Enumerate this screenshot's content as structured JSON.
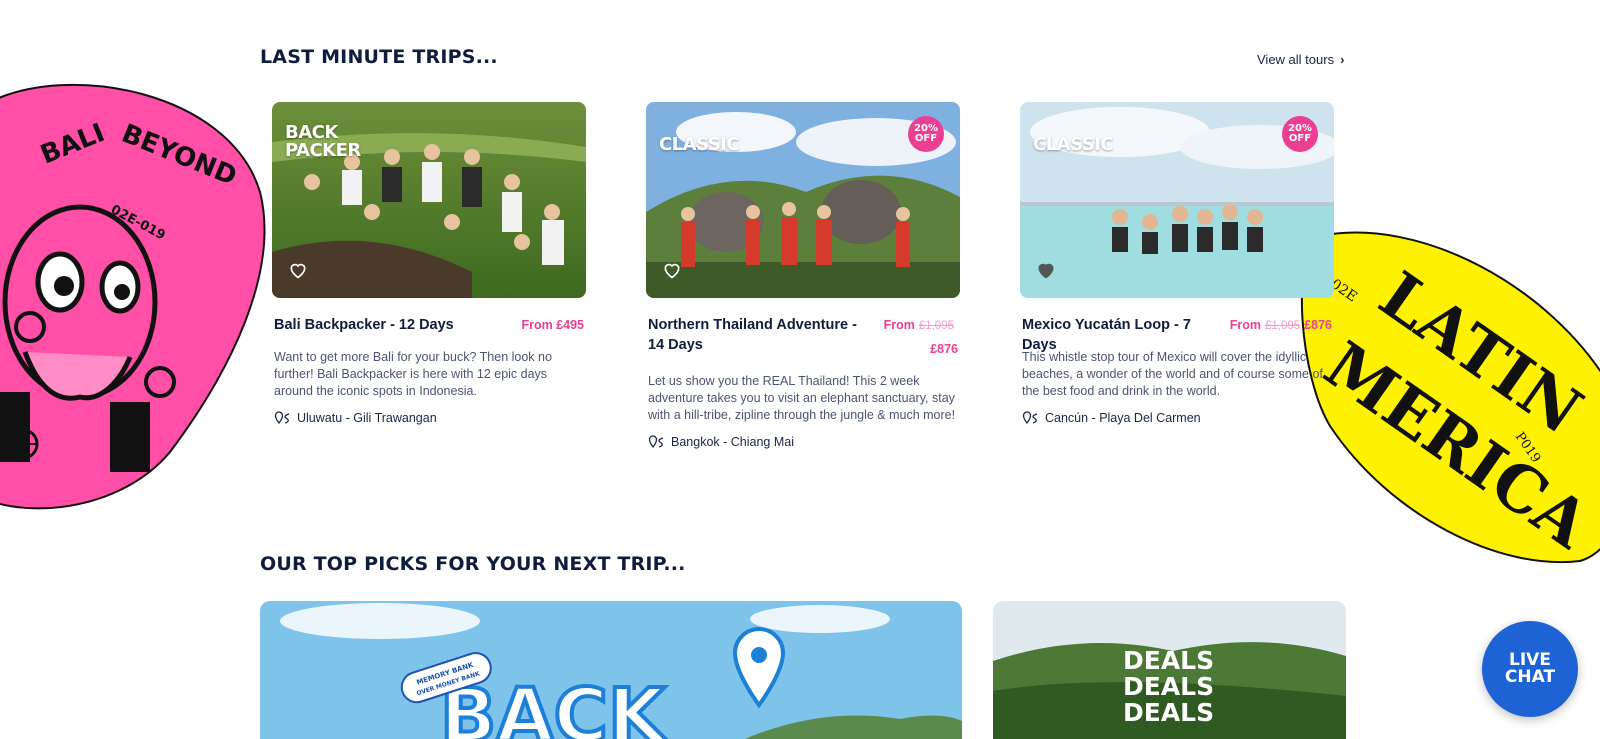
{
  "last_minute": {
    "title": "LAST MINUTE TRIPS...",
    "view_all": "View all tours",
    "cards": [
      {
        "badge_line1": "BACK",
        "badge_line2": "PACKER",
        "off": "",
        "title": "Bali Backpacker - 12 Days",
        "price_from": "From £495",
        "price_old": "",
        "price_new": "",
        "description": "Want to get more Bali for your buck? Then look no further! Bali Backpacker is here with 12 epic days around the iconic spots in Indonesia.",
        "route": "Uluwatu - Gili Trawangan"
      },
      {
        "badge_line1": "CLASSIC",
        "badge_line2": "",
        "off": "20% OFF",
        "title": "Northern Thailand Adventure - 14 Days",
        "price_from": "From",
        "price_old": "£1,095",
        "price_new": "£876",
        "description": "Let us show you the REAL Thailand! This 2 week adventure takes you to visit an elephant sanctuary, stay with a hill-tribe, zipline through the jungle & much more!",
        "route": "Bangkok - Chiang Mai"
      },
      {
        "badge_line1": "CLASSIC",
        "badge_line2": "",
        "off": "20% OFF",
        "title": "Mexico Yucatán Loop - 7 Days",
        "price_from": "From",
        "price_old": "£1,095",
        "price_new": "£876",
        "description": "This whistle stop tour of Mexico will cover the idyllic beaches, a wonder of the world and of course some of the best food and drink in the world.",
        "route": "Cancún - Playa Del Carmen"
      }
    ]
  },
  "top_picks": {
    "title": "OUR TOP PICKS FOR YOUR NEXT TRIP...",
    "pick1_text": "BACK",
    "pick1_stamp_line1": "MEMORY BANK",
    "pick1_stamp_line2": "OVER MONEY BANK",
    "pick2_line1": "DEALS",
    "pick2_line2": "DEALS",
    "pick2_line3": "DEALS"
  },
  "stickers": {
    "left_title": "BALI & BEYOND",
    "left_code": "02E-019",
    "right_title_1": "LATIN",
    "right_title_2": "MERICA",
    "right_code_1": "02E",
    "right_code_2": "P019"
  },
  "live_chat": {
    "line1": "LIVE",
    "line2": "CHAT"
  },
  "colors": {
    "pink": "#ec3e92",
    "navy": "#0f1d3d",
    "yellow": "#fff200",
    "blue": "#1e63d6"
  }
}
